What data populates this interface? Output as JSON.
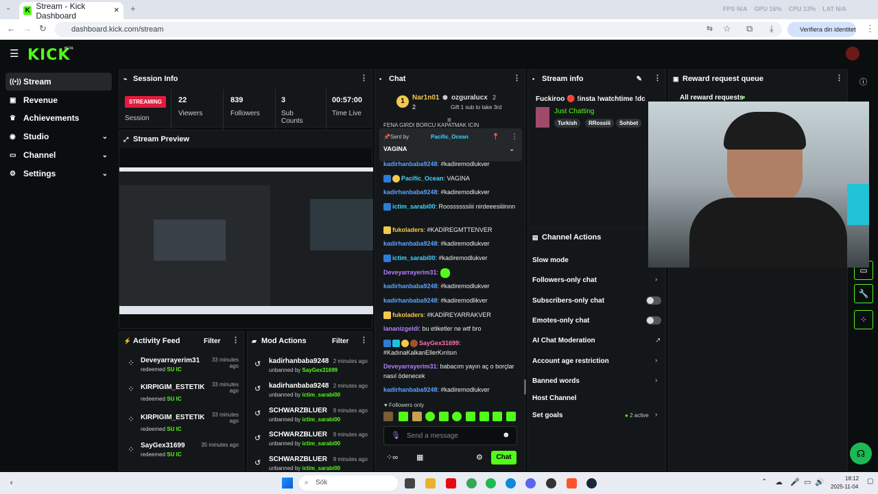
{
  "browser": {
    "tab_title": "Stream - Kick Dashboard",
    "url": "dashboard.kick.com/stream",
    "verify_label": "Verifiera din identitet",
    "fps": "FPS N/A",
    "gpu": "GPU 16%",
    "cpu": "CPU 13%",
    "lat": "LAT N/A"
  },
  "header": {
    "logo": "KICK",
    "beta": "BETA"
  },
  "sidebar": {
    "items": [
      {
        "label": "Stream"
      },
      {
        "label": "Revenue"
      },
      {
        "label": "Achievements"
      },
      {
        "label": "Studio"
      },
      {
        "label": "Channel"
      },
      {
        "label": "Settings"
      }
    ]
  },
  "session": {
    "title": "Session Info",
    "status": "STREAMING",
    "status_label": "Session",
    "viewers": "22",
    "viewers_label": "Viewers",
    "followers": "839",
    "followers_label": "Followers",
    "subs": "3",
    "subs_label": "Sub Counts",
    "time": "00:57:00",
    "time_label": "Time Live"
  },
  "preview": {
    "title": "Stream Preview"
  },
  "chat": {
    "title": "Chat",
    "top1_name": "Nar1n01",
    "top1_count": "2",
    "top2_name": "ozguralucx",
    "top2_count": "2",
    "gift_text": "Gift 1 sub to take 3rd",
    "cut_text": "FENA GIRDI BORCU KAPATMAK ICIN",
    "pinned_by": "Sent by",
    "pinned_user": "Pacific_Ocean",
    "pinned_msg": "VAGINA",
    "messages": [
      {
        "user": "kadirhanbaba9248",
        "text": ": #kadiremodlukver"
      },
      {
        "user": "Pacific_Ocean",
        "text": ": VAGINA"
      },
      {
        "user": "kadirhanbaba9248",
        "text": ": #kadiremodlukver"
      },
      {
        "user": "ictim_sarabi00",
        "text": ": Roossssssiiii nirdeeesiiiinnn"
      },
      {
        "user": "fukoladers",
        "text": ": #KADİREGMTTENVER"
      },
      {
        "user": "kadirhanbaba9248",
        "text": ": #kadiremodlukver"
      },
      {
        "user": "ictim_sarabi00",
        "text": ": #kadiremodlukver"
      },
      {
        "user": "Deveyarrayerim31",
        "text": ":"
      },
      {
        "user": "kadirhanbaba9248",
        "text": ": #kadiremodlukver"
      },
      {
        "user": "kadirhanbaba9248",
        "text": ": #kadiremodlikver"
      },
      {
        "user": "fukoladers",
        "text": ": #KADİREYARRAKVER"
      },
      {
        "user": "lananizgeldi",
        "text": ": bu etiketler ne wtf bro"
      },
      {
        "user": "SayGex31699",
        "text": ": #KadınaKalkanEllerKırılsın"
      },
      {
        "user": "Deveyarrayerim31",
        "text": ": babacım yayın aç o borçlar nasıl ödenecek"
      },
      {
        "user": "kadirhanbaba9248",
        "text": ": #kadiremodlukver"
      }
    ],
    "followers_only": "Followers only",
    "placeholder": "Send a message",
    "send": "Chat"
  },
  "stream_info": {
    "title": "Stream info",
    "stream_title": "Fuckiroo 🔴 !insta !watchtime !dc",
    "category": "Just Chatting",
    "tags": [
      "Turkish",
      "RRossiii",
      "Sohbet"
    ]
  },
  "actions": {
    "title": "Channel Actions",
    "items": [
      "Slow mode",
      "Followers-only chat",
      "Subscribers-only chat",
      "Emotes-only chat",
      "AI Chat Moderation",
      "Account age restriction",
      "Banned words",
      "Host Channel",
      "Set goals"
    ],
    "goals_active": "2 active"
  },
  "reward": {
    "title": "Reward request queue",
    "all": "All reward requests"
  },
  "activity": {
    "title": "Activity Feed",
    "filter": "Filter",
    "items": [
      {
        "user": "Deveyarrayerim31",
        "time": "33 minutes ago",
        "action": "redeemed",
        "reward": "SU IC"
      },
      {
        "user": "KIRPIGIM_ESTETIK",
        "time": "33 minutes ago",
        "action": "redeemed",
        "reward": "SU IC"
      },
      {
        "user": "KIRPIGIM_ESTETIK",
        "time": "33 minutes ago",
        "action": "redeemed",
        "reward": "SU IC"
      },
      {
        "user": "SayGex31699",
        "time": "35 minutes ago",
        "action": "redeemed",
        "reward": "SU IC"
      }
    ]
  },
  "mod": {
    "title": "Mod Actions",
    "filter": "Filter",
    "items": [
      {
        "user": "kadirhanbaba9248",
        "time": "2 minutes ago",
        "action": "unbanned by",
        "by": "SayGex31699"
      },
      {
        "user": "kadirhanbaba9248",
        "time": "2 minutes ago",
        "action": "unbanned by",
        "by": "ictim_sarabi00"
      },
      {
        "user": "SCHWARZBLUER",
        "time": "9 minutes ago",
        "action": "unbanned by",
        "by": "ictim_sarabi00"
      },
      {
        "user": "SCHWARZBLUER",
        "time": "9 minutes ago",
        "action": "unbanned by",
        "by": "ictim_sarabi00"
      },
      {
        "user": "SCHWARZBLUER",
        "time": "9 minutes ago",
        "action": "unbanned by",
        "by": "ictim_sarabi00"
      }
    ]
  },
  "taskbar": {
    "search": "Sök",
    "time": "18:12",
    "date": "2025-11-04"
  },
  "colors": {
    "brand": "#53fc18",
    "live": "#e21c3e"
  }
}
